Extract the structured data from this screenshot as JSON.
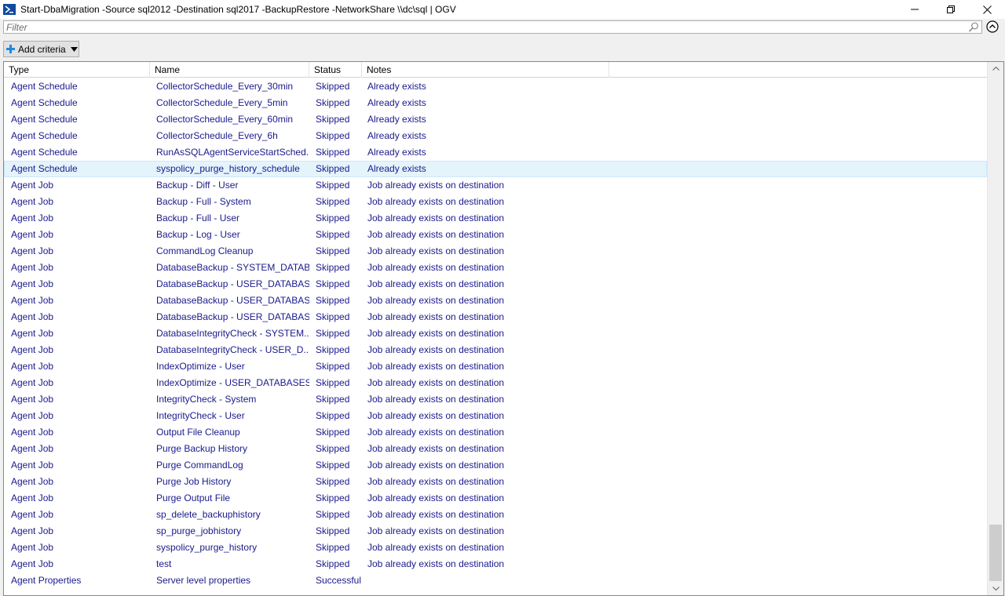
{
  "window": {
    "title": "Start-DbaMigration -Source sql2012 -Destination sql2017 -BackupRestore -NetworkShare \\\\dc\\sql | OGV"
  },
  "filter": {
    "placeholder": "Filter",
    "value": ""
  },
  "toolbar": {
    "add_criteria_label": "Add criteria"
  },
  "icons": {
    "title": "powershell-icon",
    "search": "search-icon",
    "collapse": "chevron-up-circle-icon",
    "add": "plus-icon",
    "dropdown": "triangle-down-icon"
  },
  "colors": {
    "cell_text": "#1a1a8c",
    "selected_row": "#e5f3fb",
    "accent_blue": "#0078d7"
  },
  "grid": {
    "columns": [
      "Type",
      "Name",
      "Status",
      "Notes"
    ],
    "selected_index": 5,
    "rows": [
      {
        "type": "Agent Schedule",
        "name": "CollectorSchedule_Every_30min",
        "status": "Skipped",
        "notes": "Already exists"
      },
      {
        "type": "Agent Schedule",
        "name": "CollectorSchedule_Every_5min",
        "status": "Skipped",
        "notes": "Already exists"
      },
      {
        "type": "Agent Schedule",
        "name": "CollectorSchedule_Every_60min",
        "status": "Skipped",
        "notes": "Already exists"
      },
      {
        "type": "Agent Schedule",
        "name": "CollectorSchedule_Every_6h",
        "status": "Skipped",
        "notes": "Already exists"
      },
      {
        "type": "Agent Schedule",
        "name": "RunAsSQLAgentServiceStartSched...",
        "status": "Skipped",
        "notes": "Already exists"
      },
      {
        "type": "Agent Schedule",
        "name": "syspolicy_purge_history_schedule",
        "status": "Skipped",
        "notes": "Already exists"
      },
      {
        "type": "Agent Job",
        "name": "Backup - Diff - User",
        "status": "Skipped",
        "notes": "Job already exists on destination"
      },
      {
        "type": "Agent Job",
        "name": "Backup - Full - System",
        "status": "Skipped",
        "notes": "Job already exists on destination"
      },
      {
        "type": "Agent Job",
        "name": "Backup - Full - User",
        "status": "Skipped",
        "notes": "Job already exists on destination"
      },
      {
        "type": "Agent Job",
        "name": "Backup - Log - User",
        "status": "Skipped",
        "notes": "Job already exists on destination"
      },
      {
        "type": "Agent Job",
        "name": "CommandLog Cleanup",
        "status": "Skipped",
        "notes": "Job already exists on destination"
      },
      {
        "type": "Agent Job",
        "name": "DatabaseBackup - SYSTEM_DATAB...",
        "status": "Skipped",
        "notes": "Job already exists on destination"
      },
      {
        "type": "Agent Job",
        "name": "DatabaseBackup - USER_DATABAS...",
        "status": "Skipped",
        "notes": "Job already exists on destination"
      },
      {
        "type": "Agent Job",
        "name": "DatabaseBackup - USER_DATABAS...",
        "status": "Skipped",
        "notes": "Job already exists on destination"
      },
      {
        "type": "Agent Job",
        "name": "DatabaseBackup - USER_DATABAS...",
        "status": "Skipped",
        "notes": "Job already exists on destination"
      },
      {
        "type": "Agent Job",
        "name": "DatabaseIntegrityCheck - SYSTEM...",
        "status": "Skipped",
        "notes": "Job already exists on destination"
      },
      {
        "type": "Agent Job",
        "name": "DatabaseIntegrityCheck - USER_D...",
        "status": "Skipped",
        "notes": "Job already exists on destination"
      },
      {
        "type": "Agent Job",
        "name": "IndexOptimize - User",
        "status": "Skipped",
        "notes": "Job already exists on destination"
      },
      {
        "type": "Agent Job",
        "name": "IndexOptimize - USER_DATABASES",
        "status": "Skipped",
        "notes": "Job already exists on destination"
      },
      {
        "type": "Agent Job",
        "name": "IntegrityCheck - System",
        "status": "Skipped",
        "notes": "Job already exists on destination"
      },
      {
        "type": "Agent Job",
        "name": "IntegrityCheck - User",
        "status": "Skipped",
        "notes": "Job already exists on destination"
      },
      {
        "type": "Agent Job",
        "name": "Output File Cleanup",
        "status": "Skipped",
        "notes": "Job already exists on destination"
      },
      {
        "type": "Agent Job",
        "name": "Purge Backup History",
        "status": "Skipped",
        "notes": "Job already exists on destination"
      },
      {
        "type": "Agent Job",
        "name": "Purge CommandLog",
        "status": "Skipped",
        "notes": "Job already exists on destination"
      },
      {
        "type": "Agent Job",
        "name": "Purge Job History",
        "status": "Skipped",
        "notes": "Job already exists on destination"
      },
      {
        "type": "Agent Job",
        "name": "Purge Output File",
        "status": "Skipped",
        "notes": "Job already exists on destination"
      },
      {
        "type": "Agent Job",
        "name": "sp_delete_backuphistory",
        "status": "Skipped",
        "notes": "Job already exists on destination"
      },
      {
        "type": "Agent Job",
        "name": "sp_purge_jobhistory",
        "status": "Skipped",
        "notes": "Job already exists on destination"
      },
      {
        "type": "Agent Job",
        "name": "syspolicy_purge_history",
        "status": "Skipped",
        "notes": "Job already exists on destination"
      },
      {
        "type": "Agent Job",
        "name": "test",
        "status": "Skipped",
        "notes": "Job already exists on destination"
      },
      {
        "type": "Agent Properties",
        "name": "Server level properties",
        "status": "Successful",
        "notes": ""
      }
    ]
  }
}
